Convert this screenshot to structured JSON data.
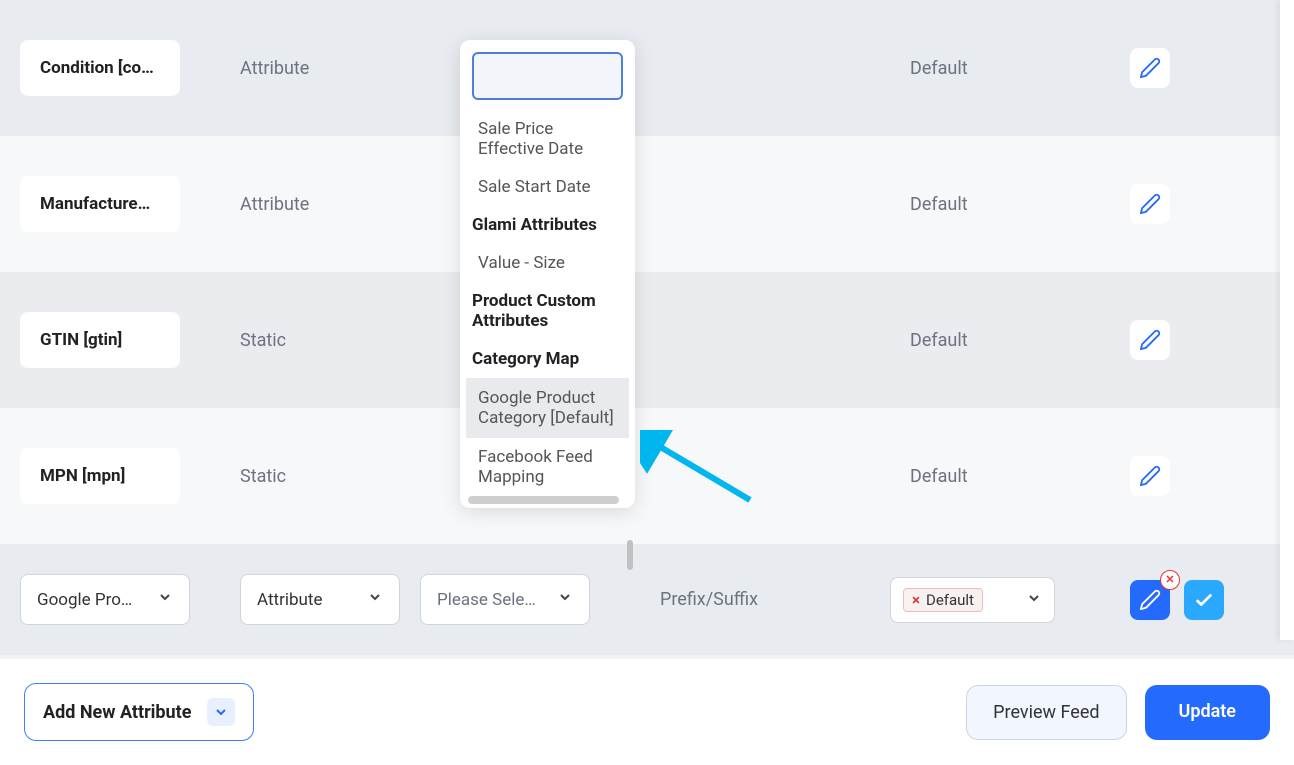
{
  "rows": [
    {
      "label": "Condition [co…",
      "type": "Attribute",
      "output": "Default"
    },
    {
      "label": "Manufacture…",
      "type": "Attribute",
      "output": "Default"
    },
    {
      "label": "GTIN [gtin]",
      "type": "Static",
      "output": "Default"
    },
    {
      "label": "MPN [mpn]",
      "type": "Static",
      "output": "Default"
    }
  ],
  "dropdown": {
    "search_placeholder": "",
    "items": [
      {
        "text": "Sale Price Effective Date",
        "kind": "item"
      },
      {
        "text": "Sale Start Date",
        "kind": "item"
      },
      {
        "text": "Glami Attributes",
        "kind": "group"
      },
      {
        "text": "Value - Size",
        "kind": "item"
      },
      {
        "text": "Product Custom Attributes",
        "kind": "group"
      },
      {
        "text": "Category Map",
        "kind": "group"
      },
      {
        "text": "Google Product Category [Default]",
        "kind": "item",
        "highlight": true
      },
      {
        "text": "Facebook Feed Mapping",
        "kind": "item"
      }
    ]
  },
  "lastRow": {
    "col1": "Google Pro…",
    "col2": "Attribute",
    "col3": "Please Sele…",
    "prefix": "Prefix/Suffix",
    "tag": "Default"
  },
  "footer": {
    "add": "Add New Attribute",
    "preview": "Preview Feed",
    "update": "Update"
  }
}
